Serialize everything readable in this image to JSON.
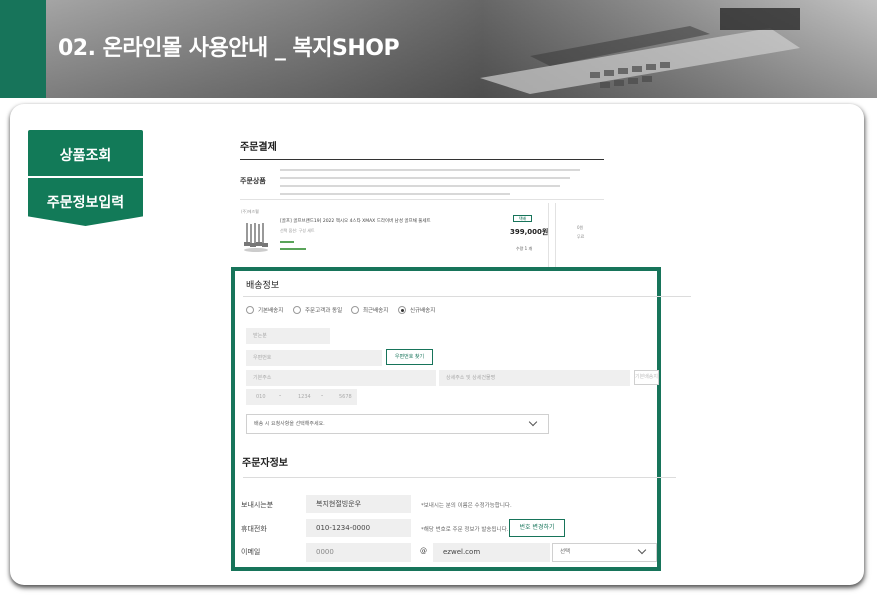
{
  "banner": {
    "title": "02. 온라인몰 사용안내 _ 복지SHOP"
  },
  "tabs": [
    {
      "label": "상품조회"
    },
    {
      "label": "주문정보입력"
    }
  ],
  "order": {
    "title": "주문결제",
    "product_section_label": "주문상품",
    "shipping_from": "(주)에즈웰",
    "product_name": "[골프] 골프브랜드19] 2022 젝시오 4스타 XMAX 드라이버 남성 골프채 풀세트",
    "option_label": "선택 옵션: 구성 세트",
    "badge": "택배",
    "price": "399,000원",
    "quantity": "수량 1 개",
    "side_note": "0원",
    "side_note2": "무료"
  },
  "shipping": {
    "title": "배송정보",
    "radio_options": [
      {
        "label": "기본배송지",
        "selected": false
      },
      {
        "label": "주문고객과 동일",
        "selected": false
      },
      {
        "label": "최근배송지",
        "selected": false
      },
      {
        "label": "신규배송지",
        "selected": true
      }
    ],
    "recipient_placeholder": "받는분",
    "postcode_placeholder": "우편번호",
    "postcode_button": "우편번호 찾기",
    "address_placeholder": "기본주소",
    "detail_placeholder": "상세주소 및 상세건물명",
    "default_address_button": "기본배송지",
    "phone_parts": [
      "010",
      "1234",
      "5678"
    ],
    "phone_separator": "-",
    "memo_placeholder": "배송 시 요청사항을 선택해주세요."
  },
  "orderer": {
    "title": "주문자정보",
    "sender_label": "보내시는분",
    "sender_value": "복지현절빙운우",
    "sender_note": "*보내시는 분의 이름은 수정가능합니다.",
    "phone_label": "휴대전화",
    "phone_value": "010-1234-0000",
    "phone_note": "*해당 번호로 주문 정보가 발송됩니다.",
    "phone_button": "번호 변경하기",
    "email_label": "이메일",
    "email_id": "0000",
    "email_at": "@",
    "email_domain": "ezwel.com",
    "email_select": "선택"
  },
  "colors": {
    "brand_green": "#17745a"
  }
}
